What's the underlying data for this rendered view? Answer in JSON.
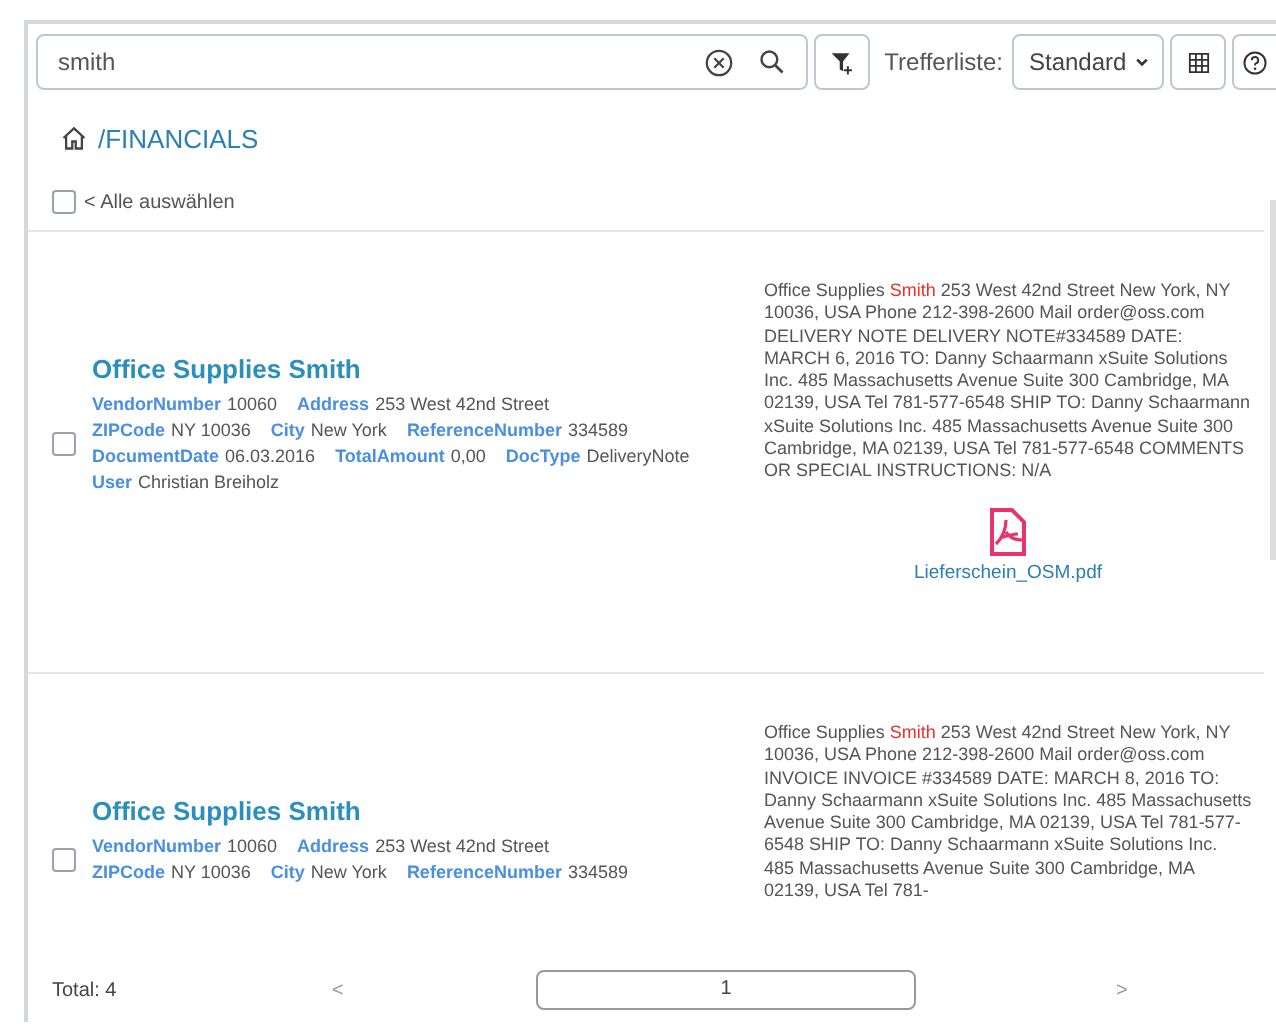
{
  "search": {
    "value": "smith"
  },
  "toolbar": {
    "result_list_label": "Trefferliste:",
    "result_list_value": "Standard"
  },
  "breadcrumb": "/FINANCIALS",
  "select_all": {
    "label": "< Alle auswählen",
    "checked": false
  },
  "results": [
    {
      "title": "Office Supplies Smith",
      "checked": false,
      "field_lines": [
        [
          {
            "label": "VendorNumber",
            "value": "10060"
          },
          {
            "label": "Address",
            "value": "253 West 42nd Street"
          }
        ],
        [
          {
            "label": "ZIPCode",
            "value": "NY 10036"
          },
          {
            "label": "City",
            "value": "New York"
          },
          {
            "label": "ReferenceNumber",
            "value": "334589"
          }
        ],
        [
          {
            "label": "DocumentDate",
            "value": "06.03.2016"
          },
          {
            "label": "TotalAmount",
            "value": "0,00"
          },
          {
            "label": "DocType",
            "value": "DeliveryNote"
          }
        ],
        [
          {
            "label": "User",
            "value": "Christian Breiholz"
          }
        ]
      ],
      "snippet": [
        {
          "text": "Office Supplies ",
          "highlight": false
        },
        {
          "text": "Smith",
          "highlight": true
        },
        {
          "text": " 253 West 42nd Street New York, NY 10036, USA Phone 212-398-2600 Mail order@oss.com DELIVERY NOTE DELIVERY NOTE#334589 DATE: MARCH 6, 2016 TO: Danny Schaarmann xSuite Solutions Inc. 485 Massachusetts Avenue Suite 300 Cambridge, MA 02139, USA Tel 781-577-6548 SHIP TO: Danny Schaarmann xSuite Solutions Inc. 485 Massachusetts Avenue Suite 300 Cambridge, MA 02139, USA Tel 781-577-6548 COMMENTS OR SPECIAL INSTRUCTIONS: N/A",
          "highlight": false
        }
      ],
      "attachment": "Lieferschein_OSM.pdf"
    },
    {
      "title": "Office Supplies Smith",
      "checked": false,
      "field_lines": [
        [
          {
            "label": "VendorNumber",
            "value": "10060"
          },
          {
            "label": "Address",
            "value": "253 West 42nd Street"
          }
        ],
        [
          {
            "label": "ZIPCode",
            "value": "NY 10036"
          },
          {
            "label": "City",
            "value": "New York"
          },
          {
            "label": "ReferenceNumber",
            "value": "334589"
          }
        ]
      ],
      "snippet": [
        {
          "text": "Office Supplies ",
          "highlight": false
        },
        {
          "text": "Smith",
          "highlight": true
        },
        {
          "text": " 253 West 42nd Street New York, NY 10036, USA Phone 212-398-2600 Mail order@oss.com INVOICE INVOICE #334589 DATE: MARCH 8, 2016 TO: Danny Schaarmann xSuite Solutions Inc. 485 Massachusetts Avenue Suite 300 Cambridge, MA 02139, USA Tel 781-577-6548 SHIP TO: Danny Schaarmann xSuite Solutions Inc. 485 Massachusetts Avenue Suite 300 Cambridge, MA 02139, USA Tel 781-",
          "highlight": false
        }
      ]
    }
  ],
  "footer": {
    "total": "Total: 4",
    "prev": "<",
    "page": "1",
    "next": ">"
  }
}
